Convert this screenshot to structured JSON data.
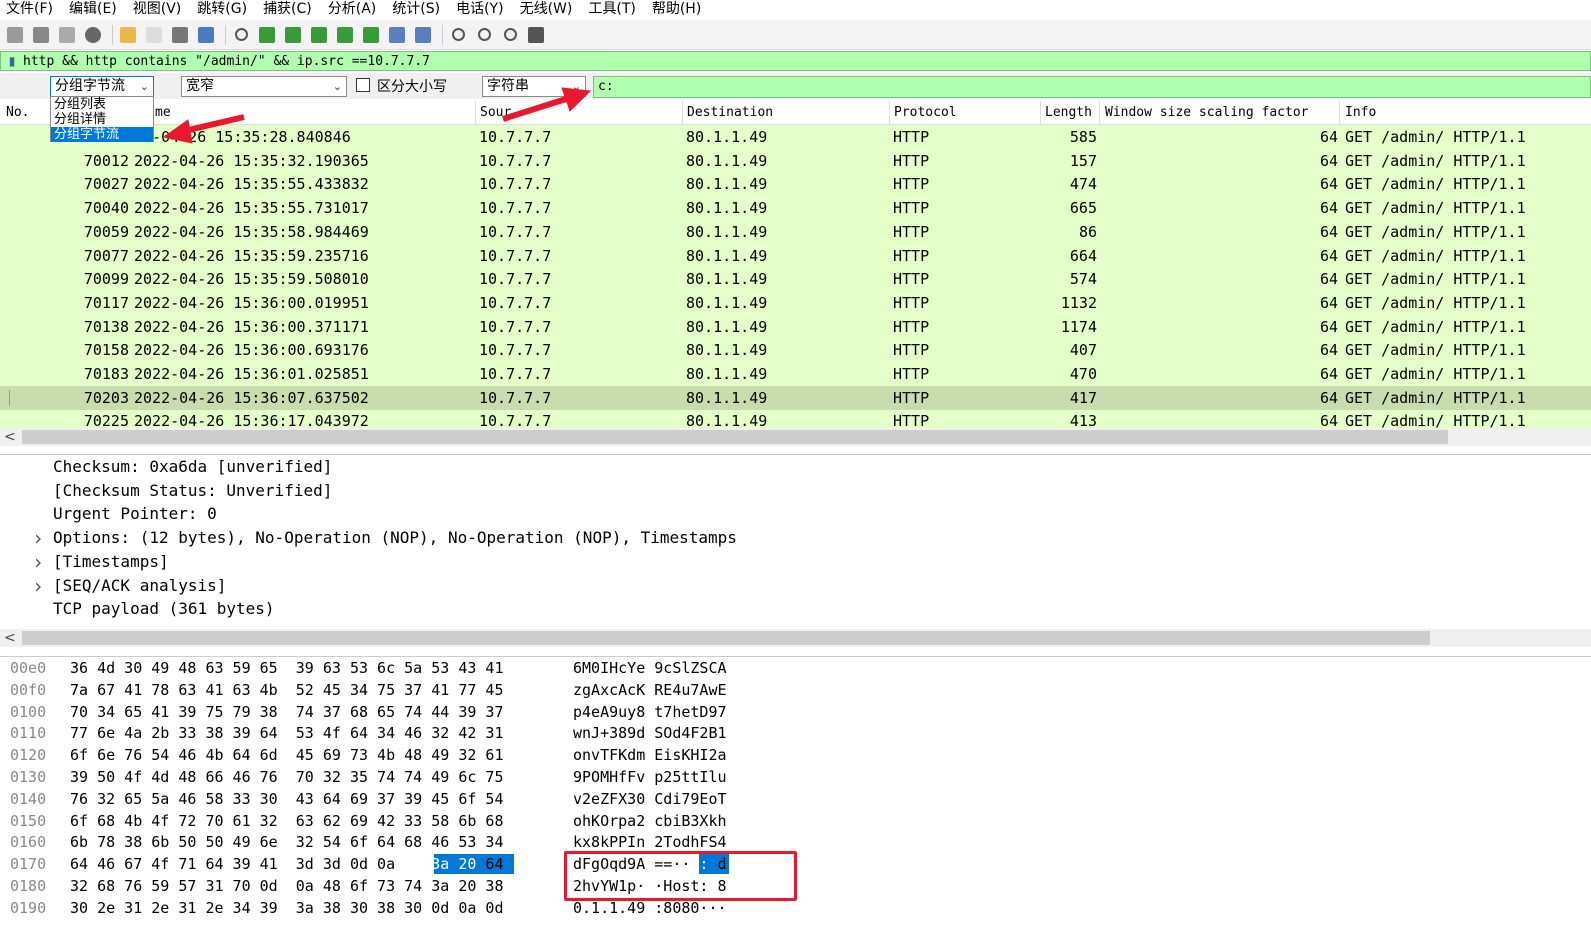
{
  "menu": [
    "文件(F)",
    "编辑(E)",
    "视图(V)",
    "跳转(G)",
    "捕获(C)",
    "分析(A)",
    "统计(S)",
    "电话(Y)",
    "无线(W)",
    "工具(T)",
    "帮助(H)"
  ],
  "toolbar_icons": [
    "shark-fin-start-icon",
    "stop-icon",
    "restart-icon",
    "options-gear-icon",
    "open-folder-icon",
    "file-icon",
    "close-file-icon",
    "reload-icon",
    "find-icon",
    "back-arrow-icon",
    "forward-arrow-icon",
    "goto-packet-icon",
    "first-packet-icon",
    "last-packet-icon",
    "autoscroll-icon",
    "colorize-icon",
    "zoom-in-icon",
    "zoom-out-icon",
    "normal-size-icon",
    "resize-columns-icon"
  ],
  "display_filter": {
    "value": "http && http contains \"/admin/\" && ip.src ==10.7.7.7"
  },
  "find_bar": {
    "search_in": "分组字节流",
    "char_width": "宽窄",
    "case_label": "区分大小写",
    "search_type": "字符串",
    "search_value": "c:",
    "dropdown_options": [
      "分组列表",
      "分组详情",
      "分组字节流"
    ]
  },
  "packet_list": {
    "columns": [
      "No.",
      "Time",
      "Source",
      "Destination",
      "Protocol",
      "Length",
      "Window size scaling factor",
      "Info"
    ],
    "column_time_visible": "me",
    "column_source_visible": "Sour",
    "rows": [
      {
        "no": "",
        "time": "22-04-26 15:35:28.840846",
        "src": "10.7.7.7",
        "dst": "80.1.1.49",
        "proto": "HTTP",
        "len": "585",
        "wsf": "64",
        "info": "GET /admin/ HTTP/1.1"
      },
      {
        "no": "70012",
        "time": "2022-04-26 15:35:32.190365",
        "src": "10.7.7.7",
        "dst": "80.1.1.49",
        "proto": "HTTP",
        "len": "157",
        "wsf": "64",
        "info": "GET /admin/ HTTP/1.1"
      },
      {
        "no": "70027",
        "time": "2022-04-26 15:35:55.433832",
        "src": "10.7.7.7",
        "dst": "80.1.1.49",
        "proto": "HTTP",
        "len": "474",
        "wsf": "64",
        "info": "GET /admin/ HTTP/1.1"
      },
      {
        "no": "70040",
        "time": "2022-04-26 15:35:55.731017",
        "src": "10.7.7.7",
        "dst": "80.1.1.49",
        "proto": "HTTP",
        "len": "665",
        "wsf": "64",
        "info": "GET /admin/ HTTP/1.1"
      },
      {
        "no": "70059",
        "time": "2022-04-26 15:35:58.984469",
        "src": "10.7.7.7",
        "dst": "80.1.1.49",
        "proto": "HTTP",
        "len": "86",
        "wsf": "64",
        "info": "GET /admin/ HTTP/1.1"
      },
      {
        "no": "70077",
        "time": "2022-04-26 15:35:59.235716",
        "src": "10.7.7.7",
        "dst": "80.1.1.49",
        "proto": "HTTP",
        "len": "664",
        "wsf": "64",
        "info": "GET /admin/ HTTP/1.1"
      },
      {
        "no": "70099",
        "time": "2022-04-26 15:35:59.508010",
        "src": "10.7.7.7",
        "dst": "80.1.1.49",
        "proto": "HTTP",
        "len": "574",
        "wsf": "64",
        "info": "GET /admin/ HTTP/1.1"
      },
      {
        "no": "70117",
        "time": "2022-04-26 15:36:00.019951",
        "src": "10.7.7.7",
        "dst": "80.1.1.49",
        "proto": "HTTP",
        "len": "1132",
        "wsf": "64",
        "info": "GET /admin/ HTTP/1.1"
      },
      {
        "no": "70138",
        "time": "2022-04-26 15:36:00.371171",
        "src": "10.7.7.7",
        "dst": "80.1.1.49",
        "proto": "HTTP",
        "len": "1174",
        "wsf": "64",
        "info": "GET /admin/ HTTP/1.1"
      },
      {
        "no": "70158",
        "time": "2022-04-26 15:36:00.693176",
        "src": "10.7.7.7",
        "dst": "80.1.1.49",
        "proto": "HTTP",
        "len": "407",
        "wsf": "64",
        "info": "GET /admin/ HTTP/1.1"
      },
      {
        "no": "70183",
        "time": "2022-04-26 15:36:01.025851",
        "src": "10.7.7.7",
        "dst": "80.1.1.49",
        "proto": "HTTP",
        "len": "470",
        "wsf": "64",
        "info": "GET /admin/ HTTP/1.1"
      },
      {
        "no": "70203",
        "time": "2022-04-26 15:36:07.637502",
        "src": "10.7.7.7",
        "dst": "80.1.1.49",
        "proto": "HTTP",
        "len": "417",
        "wsf": "64",
        "info": "GET /admin/ HTTP/1.1"
      },
      {
        "no": "70225",
        "time": "2022-04-26 15:36:17.043972",
        "src": "10.7.7.7",
        "dst": "80.1.1.49",
        "proto": "HTTP",
        "len": "413",
        "wsf": "64",
        "info": "GET /admin/ HTTP/1.1"
      }
    ],
    "selected_no": "70203"
  },
  "details": [
    {
      "expandable": false,
      "text": "Checksum: 0xa6da [unverified]"
    },
    {
      "expandable": false,
      "text": "[Checksum Status: Unverified]"
    },
    {
      "expandable": false,
      "text": "Urgent Pointer: 0"
    },
    {
      "expandable": true,
      "text": "Options: (12 bytes), No-Operation (NOP), No-Operation (NOP), Timestamps"
    },
    {
      "expandable": true,
      "text": "[Timestamps]"
    },
    {
      "expandable": true,
      "text": "[SEQ/ACK analysis]"
    },
    {
      "expandable": false,
      "text": "TCP payload (361 bytes)"
    }
  ],
  "bytes": [
    {
      "offset": "00e0",
      "hex": "36 4d 30 49 48 63 59 65  39 63 53 6c 5a 53 43 41",
      "ascii": "6M0IHcYe 9cSlZSCA"
    },
    {
      "offset": "00f0",
      "hex": "7a 67 41 78 63 41 63 4b  52 45 34 75 37 41 77 45",
      "ascii": "zgAxcAcK RE4u7AwE"
    },
    {
      "offset": "0100",
      "hex": "70 34 65 41 39 75 79 38  74 37 68 65 74 44 39 37",
      "ascii": "p4eA9uy8 t7hetD97"
    },
    {
      "offset": "0110",
      "hex": "77 6e 4a 2b 33 38 39 64  53 4f 64 34 46 32 42 31",
      "ascii": "wnJ+389d SOd4F2B1"
    },
    {
      "offset": "0120",
      "hex": "6f 6e 76 54 46 4b 64 6d  45 69 73 4b 48 49 32 61",
      "ascii": "onvTFKdm EisKHI2a"
    },
    {
      "offset": "0130",
      "hex": "39 50 4f 4d 48 66 46 76  70 32 35 74 74 49 6c 75",
      "ascii": "9POMHfFv p25ttIlu"
    },
    {
      "offset": "0140",
      "hex": "76 32 65 5a 46 58 33 30  43 64 69 37 39 45 6f 54",
      "ascii": "v2eZFX30 Cdi79EoT"
    },
    {
      "offset": "0150",
      "hex": "6f 68 4b 4f 72 70 61 32  63 62 69 42 33 58 6b 68",
      "ascii": "ohKOrpa2 cbiB3Xkh"
    },
    {
      "offset": "0160",
      "hex": "6b 78 38 6b 50 50 49 6e  32 54 6f 64 68 46 53 34",
      "ascii": "kx8kPPIn 2TodhFS4"
    },
    {
      "offset": "0170",
      "hex": "64 46 67 4f 71 64 39 41  3d 3d 0d 0a 63 3a 20 64",
      "ascii": "dFgOqd9A ==··c: d"
    },
    {
      "offset": "0180",
      "hex": "32 68 76 59 57 31 70 0d  0a 48 6f 73 74 3a 20 38",
      "ascii": "2hvYW1p· ·Host: 8"
    },
    {
      "offset": "0190",
      "hex": "30 2e 31 2e 31 2e 34 39  3a 38 30 38 30 0d 0a 0d",
      "ascii": "0.1.1.49 :8080···"
    }
  ],
  "colors": {
    "http_row": "#e4ffc7",
    "selected_row": "#c9dcae",
    "filter_ok": "#afffaf",
    "highlight": "#0078d7",
    "annotation_red": "#e8192c"
  }
}
